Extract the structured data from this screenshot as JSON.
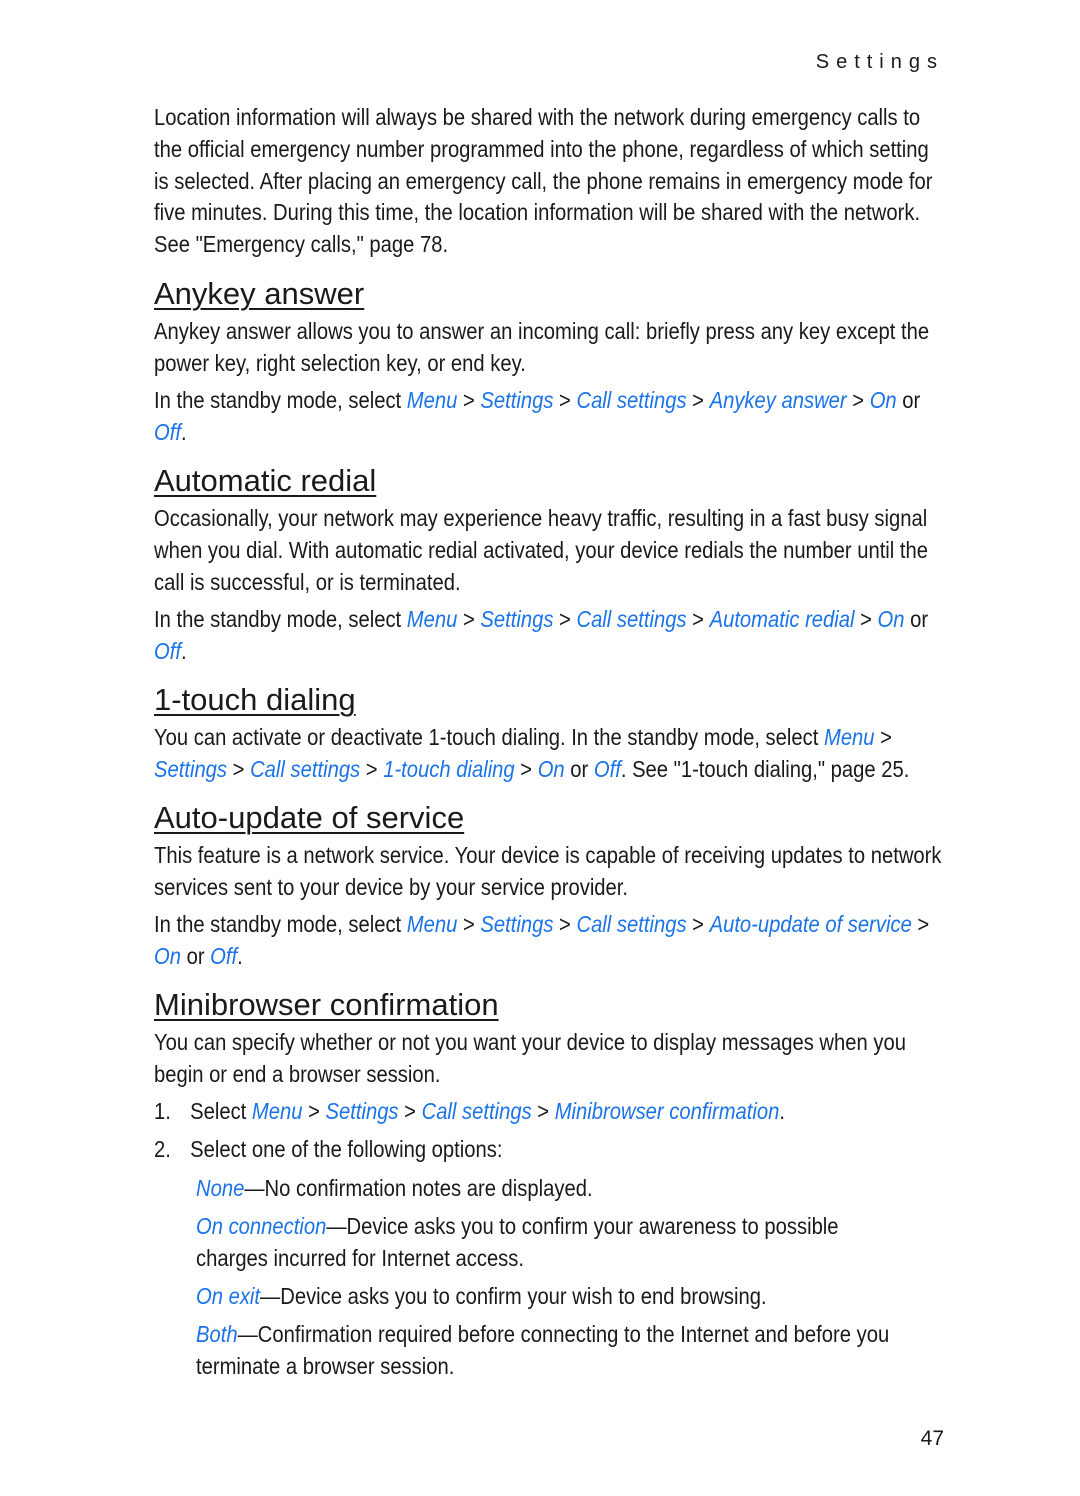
{
  "running_head": "Settings",
  "page_number": "47",
  "link_color": "#1a73e8",
  "intro": "Location information will always be shared with the network during emergency calls to the official emergency number programmed into the phone, regardless of which setting is selected. After placing an emergency call, the phone remains in emergency mode for five minutes. During this time, the location information will be shared with the network. See \"Emergency calls,\" page 78.",
  "sections": {
    "anykey": {
      "title": "Anykey answer",
      "body": "Anykey answer allows you to answer an incoming call: briefly press any key except the power key, right selection key, or end key.",
      "prefix": "In the standby mode, select ",
      "path": [
        "Menu",
        "Settings",
        "Call settings",
        "Anykey answer"
      ],
      "on": "On",
      "or": " or ",
      "off": "Off",
      "end": "."
    },
    "redial": {
      "title": "Automatic redial",
      "body": "Occasionally, your network may experience heavy traffic, resulting in a fast busy signal when you dial. With automatic redial activated, your device redials the number until the call is successful, or is terminated.",
      "prefix": "In the standby mode, select ",
      "path": [
        "Menu",
        "Settings",
        "Call settings",
        "Automatic redial"
      ],
      "on": "On",
      "or": " or ",
      "off": "Off",
      "end": "."
    },
    "onetouch": {
      "title": "1-touch dialing",
      "prefix": "You can activate or deactivate 1-touch dialing. In the standby mode, select ",
      "path": [
        "Menu",
        "Settings",
        "Call settings",
        "1-touch dialing"
      ],
      "on": "On",
      "or": " or ",
      "off": "Off",
      "suffix": ". See \"1-touch dialing,\" page 25."
    },
    "autoupdate": {
      "title": "Auto-update of service",
      "body": "This feature is a network service. Your device is capable of receiving updates to network services sent to your device by your service provider.",
      "prefix": "In the standby mode, select ",
      "path": [
        "Menu",
        "Settings",
        "Call settings",
        "Auto-update of service"
      ],
      "on": "On",
      "or": " or ",
      "off": "Off",
      "end": "."
    },
    "minibrowser": {
      "title": "Minibrowser confirmation",
      "body": "You can specify whether or not you want your device to display messages when you begin or end a browser session.",
      "step1_num": "1.",
      "step1_prefix": "Select ",
      "path": [
        "Menu",
        "Settings",
        "Call settings",
        "Minibrowser confirmation"
      ],
      "step1_end": ".",
      "step2_num": "2.",
      "step2_text": "Select one of the following options:",
      "options": [
        {
          "name": "None",
          "desc": "—No confirmation notes are displayed."
        },
        {
          "name": "On connection",
          "desc": "—Device asks you to confirm your awareness to possible charges incurred for Internet access."
        },
        {
          "name": "On exit",
          "desc": "—Device asks you to confirm your wish to end browsing."
        },
        {
          "name": "Both",
          "desc": "—Confirmation required before connecting to the Internet and before you terminate a browser session."
        }
      ]
    },
    "sep": " > "
  }
}
